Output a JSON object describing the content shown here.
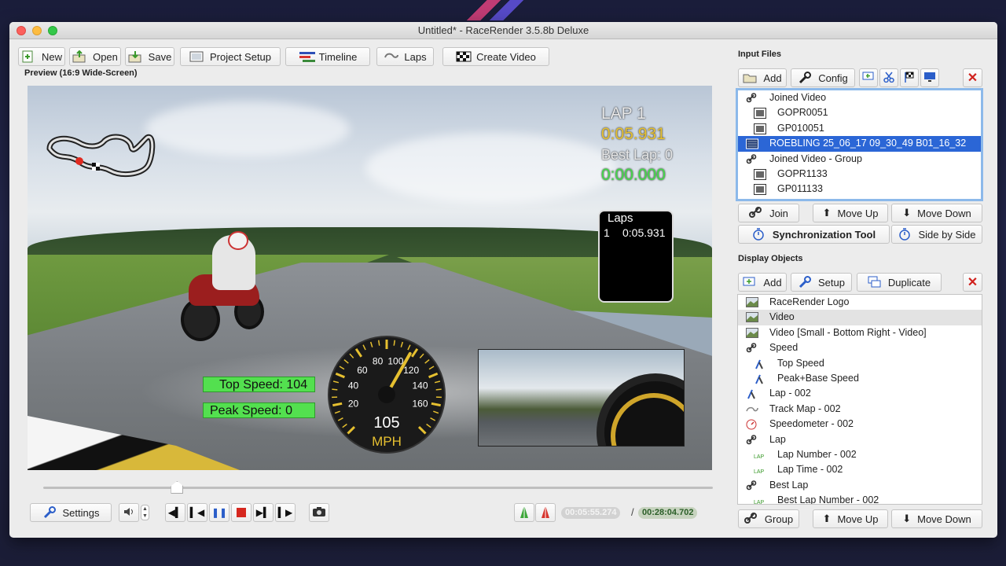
{
  "window": {
    "title": "Untitled* - RaceRender 3.5.8b Deluxe"
  },
  "toolbar": {
    "new": "New",
    "open": "Open",
    "save": "Save",
    "project_setup": "Project Setup",
    "timeline": "Timeline",
    "laps": "Laps",
    "create_video": "Create Video"
  },
  "preview": {
    "label": "Preview (16:9 Wide-Screen)",
    "hud": {
      "lap_label": "LAP 1",
      "lap_time": "0:05.931",
      "best_lap_label": "Best Lap: 0",
      "best_lap_time": "0:00.000",
      "laps_box_title": "Laps",
      "laps_box_number": "1",
      "laps_box_time": "0:05.931",
      "top_speed": "Top Speed: 104",
      "peak_speed": "Peak Speed: 0",
      "gauge_value": "105",
      "gauge_unit": "MPH",
      "gauge_ticks": [
        "20",
        "40",
        "60",
        "80",
        "100",
        "120",
        "140",
        "160"
      ],
      "gauge_fraction": 0.61
    }
  },
  "playback": {
    "settings": "Settings",
    "position_fraction": 0.2,
    "current_time": "00:05:55.274",
    "separator": "/",
    "total_time": "00:28:04.702"
  },
  "input_files": {
    "title": "Input Files",
    "add": "Add",
    "config": "Config",
    "items": [
      {
        "label": "Joined Video",
        "indent": 0,
        "icon": "link-icon"
      },
      {
        "label": "GOPR0051",
        "indent": 1,
        "icon": "film-icon"
      },
      {
        "label": "GP010051",
        "indent": 1,
        "icon": "film-icon"
      },
      {
        "label": "ROEBLING 25_06_17 09_30_49 B01_16_32",
        "indent": 0,
        "icon": "data-icon",
        "selected": true
      },
      {
        "label": "Joined Video - Group",
        "indent": 0,
        "icon": "link-icon"
      },
      {
        "label": "GOPR1133",
        "indent": 1,
        "icon": "film-icon"
      },
      {
        "label": "GP011133",
        "indent": 1,
        "icon": "film-icon"
      }
    ],
    "join": "Join",
    "move_up": "Move Up",
    "move_down": "Move Down",
    "sync_tool": "Synchronization Tool",
    "side_by_side": "Side by Side"
  },
  "display_objects": {
    "title": "Display Objects",
    "add": "Add",
    "setup": "Setup",
    "duplicate": "Duplicate",
    "items": [
      {
        "label": "RaceRender Logo",
        "indent": 0,
        "icon": "image-icon"
      },
      {
        "label": "Video",
        "indent": 0,
        "icon": "image-icon",
        "highlighted": true
      },
      {
        "label": "Video [Small - Bottom Right - Video]",
        "indent": 0,
        "icon": "image-icon"
      },
      {
        "label": "Speed",
        "indent": 0,
        "icon": "link-icon"
      },
      {
        "label": "Top Speed",
        "indent": 1,
        "icon": "tools-icon"
      },
      {
        "label": "Peak+Base Speed",
        "indent": 1,
        "icon": "tools-icon"
      },
      {
        "label": "Lap - 002",
        "indent": 0,
        "icon": "tools-icon"
      },
      {
        "label": "Track Map - 002",
        "indent": 0,
        "icon": "track-icon"
      },
      {
        "label": "Speedometer - 002",
        "indent": 0,
        "icon": "gauge-icon"
      },
      {
        "label": "Lap",
        "indent": 0,
        "icon": "link-icon"
      },
      {
        "label": "Lap Number - 002",
        "indent": 1,
        "icon": "lap-icon"
      },
      {
        "label": "Lap Time - 002",
        "indent": 1,
        "icon": "lap-icon"
      },
      {
        "label": "Best Lap",
        "indent": 0,
        "icon": "link-icon"
      },
      {
        "label": "Best Lap Number - 002",
        "indent": 1,
        "icon": "lap-icon"
      }
    ],
    "group": "Group",
    "move_up": "Move Up",
    "move_down": "Move Down"
  },
  "colors": {
    "selection": "#2b66d6",
    "hud_green": "#53e04f",
    "hud_gold": "#e6c030",
    "delete_red": "#d0201c"
  }
}
